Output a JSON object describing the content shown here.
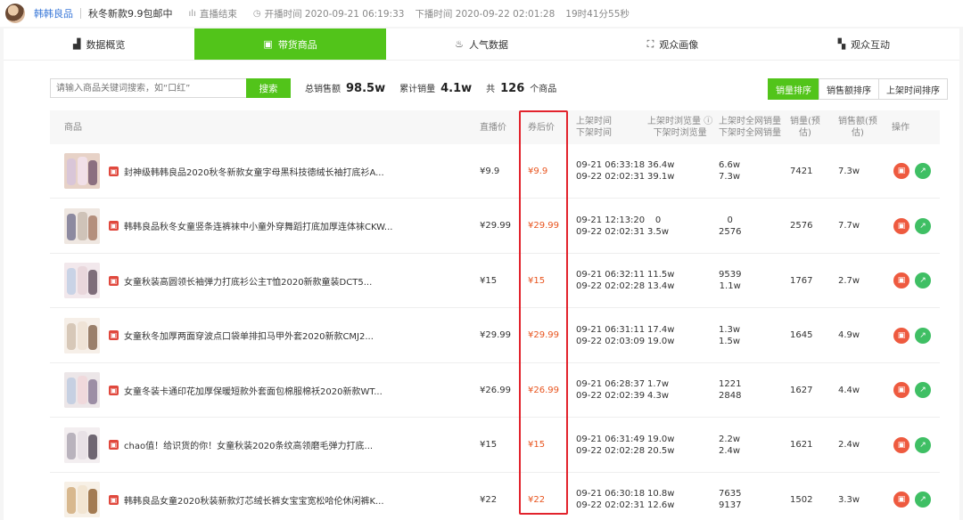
{
  "header": {
    "shop_name": "韩韩良品",
    "live_title": "秋冬新款9.9包邮中",
    "status": "直播结束",
    "start_label": "开播时间 2020-09-21 06:19:33",
    "end_label": "下播时间 2020-09-22 02:01:28",
    "duration": "19时41分55秒"
  },
  "nav": [
    {
      "label": "数据概览",
      "icon": "bar-chart-icon"
    },
    {
      "label": "带货商品",
      "icon": "shopping-bag-icon"
    },
    {
      "label": "人气数据",
      "icon": "fire-icon"
    },
    {
      "label": "观众画像",
      "icon": "portrait-icon"
    },
    {
      "label": "观众互动",
      "icon": "chat-icon"
    }
  ],
  "search": {
    "placeholder": "请输入商品关键词搜索，如“口红”",
    "button": "搜索"
  },
  "stats": {
    "sales_amount_label": "总销售额",
    "sales_amount": "98.5w",
    "total_sales_label": "累计销量",
    "total_sales": "4.1w",
    "count_prefix": "共",
    "count": "126",
    "count_suffix": "个商品"
  },
  "sort": [
    "销量排序",
    "销售额排序",
    "上架时间排序"
  ],
  "table": {
    "headers": {
      "product": "商品",
      "live_price": "直播价",
      "after_coupon": "券后价",
      "time_1": "上架时间",
      "time_2": "下架时间",
      "views_1": "上架时浏览量",
      "views_2": "下架时浏览量",
      "net_1": "上架时全网销量",
      "net_2": "下架时全网销量",
      "sales_1": "销量(预",
      "sales_2": "估)",
      "amount_1": "销售额(预",
      "amount_2": "估)",
      "op": "操作"
    },
    "rows": [
      {
        "name": "封神级韩韩良品2020秋冬新款女童字母黑科技德绒长袖打底衫A...",
        "live_price": "¥9.9",
        "after": "¥9.9",
        "on_time": "09-21 06:33:18",
        "off_time": "09-22 02:02:31",
        "views_on": "36.4w",
        "views_off": "39.1w",
        "net_on": "6.6w",
        "net_off": "7.3w",
        "sales": "7421",
        "amount": "7.3w"
      },
      {
        "name": "韩韩良品秋冬女童竖条连裤袜中小童外穿舞蹈打底加厚连体袜CKW...",
        "live_price": "¥29.99",
        "after": "¥29.99",
        "on_time": "09-21 12:13:20",
        "off_time": "09-22 02:02:31",
        "views_on": "0",
        "views_off": "3.5w",
        "net_on": "0",
        "net_off": "2576",
        "sales": "2576",
        "amount": "7.7w"
      },
      {
        "name": "女童秋装高圆领长袖弹力打底衫公主T恤2020新款童装DCT5...",
        "live_price": "¥15",
        "after": "¥15",
        "on_time": "09-21 06:32:11",
        "off_time": "09-22 02:02:28",
        "views_on": "11.5w",
        "views_off": "13.4w",
        "net_on": "9539",
        "net_off": "1.1w",
        "sales": "1767",
        "amount": "2.7w"
      },
      {
        "name": "女童秋冬加厚两面穿波点口袋单排扣马甲外套2020新款CMJ2...",
        "live_price": "¥29.99",
        "after": "¥29.99",
        "on_time": "09-21 06:31:11",
        "off_time": "09-22 02:03:09",
        "views_on": "17.4w",
        "views_off": "19.0w",
        "net_on": "1.3w",
        "net_off": "1.5w",
        "sales": "1645",
        "amount": "4.9w"
      },
      {
        "name": "女童冬装卡通印花加厚保暖短款外套面包棉服棉袄2020新款WT...",
        "live_price": "¥26.99",
        "after": "¥26.99",
        "on_time": "09-21 06:28:37",
        "off_time": "09-22 02:02:39",
        "views_on": "1.7w",
        "views_off": "4.3w",
        "net_on": "1221",
        "net_off": "2848",
        "sales": "1627",
        "amount": "4.4w"
      },
      {
        "name": "chao值！给识货的你！女童秋装2020条纹高领磨毛弹力打底...",
        "live_price": "¥15",
        "after": "¥15",
        "on_time": "09-21 06:31:49",
        "off_time": "09-22 02:02:28",
        "views_on": "19.0w",
        "views_off": "20.5w",
        "net_on": "2.2w",
        "net_off": "2.4w",
        "sales": "1621",
        "amount": "2.4w"
      },
      {
        "name": "韩韩良品女童2020秋装新款灯芯绒长裤女宝宝宽松哈伦休闲裤K...",
        "live_price": "¥22",
        "after": "¥22",
        "on_time": "09-21 06:30:18",
        "off_time": "09-22 02:02:31",
        "views_on": "10.8w",
        "views_off": "12.6w",
        "net_on": "7635",
        "net_off": "9137",
        "sales": "1502",
        "amount": "3.3w"
      }
    ]
  },
  "colors": {
    "accent": "#52c41a",
    "price": "#e8541e",
    "highlight": "#e2232c"
  }
}
